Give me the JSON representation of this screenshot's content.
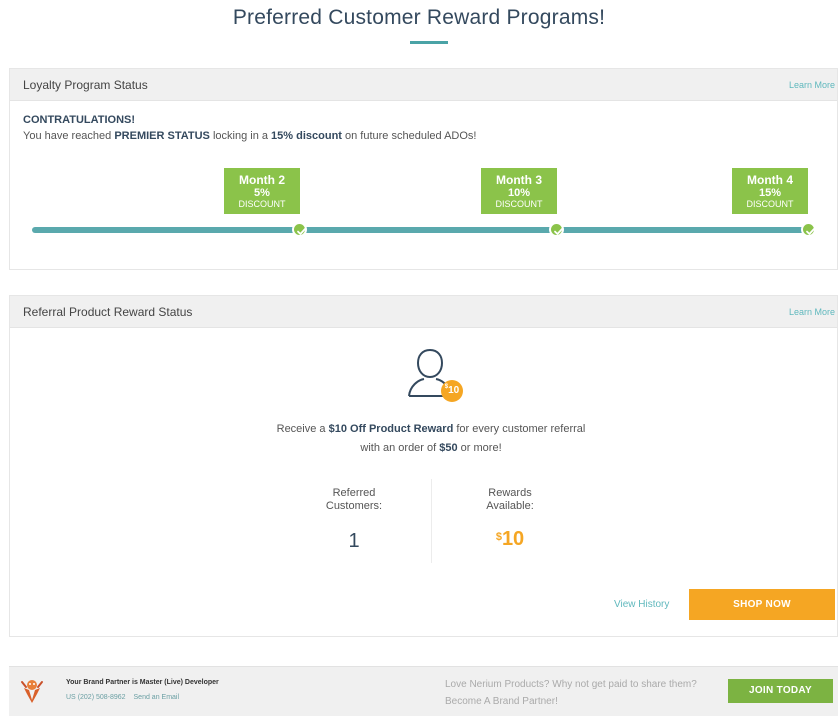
{
  "page": {
    "title": "Preferred Customer Reward Programs!"
  },
  "loyalty": {
    "header_title": "Loyalty Program Status",
    "learn_more": "Learn More",
    "congrats_heading": "CONTRATULATIONS!",
    "message_prefix": "You have reached ",
    "message_status": "PREMIER STATUS",
    "message_middle": " locking in a ",
    "message_discount": "15% discount",
    "message_suffix": " on future scheduled ADOs!",
    "milestones": [
      {
        "month": "Month 2",
        "percent": "5%",
        "label": "DISCOUNT"
      },
      {
        "month": "Month 3",
        "percent": "10%",
        "label": "DISCOUNT"
      },
      {
        "month": "Month 4",
        "percent": "15%",
        "label": "DISCOUNT"
      }
    ],
    "progress_fraction": 1.0
  },
  "referral": {
    "header_title": "Referral Product Reward Status",
    "learn_more": "Learn More",
    "badge_currency": "$",
    "badge_amount": "10",
    "desc_prefix": "Receive a ",
    "desc_reward": "$10 Off Product Reward",
    "desc_middle": " for every customer referral with an order of ",
    "desc_min": "$50",
    "desc_suffix": " or more!",
    "referred_label_1": "Referred",
    "referred_label_2": "Customers:",
    "referred_value": "1",
    "rewards_label_1": "Rewards",
    "rewards_label_2": "Available:",
    "rewards_currency": "$",
    "rewards_value": "10",
    "view_history": "View History",
    "shop_now": "SHOP NOW"
  },
  "footer": {
    "partner_prefix": "Your Brand Partner is ",
    "partner_name": "Master (Live) Developer",
    "country": "US",
    "phone": "(202) 508-8962",
    "email_link": "Send an Email",
    "promo_text": "Love Nerium Products? Why not get paid to share them?",
    "promo_link": "Become A Brand Partner!",
    "join_button": "JOIN TODAY"
  },
  "colors": {
    "accent_teal": "#5aa9ad",
    "milestone_green": "#8bc34a",
    "orange": "#f5a623",
    "join_green": "#7cb342",
    "heading_navy": "#34495e"
  },
  "icons": {
    "milestone_check": "check-circle-icon",
    "referral_avatar": "user-outline-icon",
    "partner_avatar": "mascot-avatar-icon"
  }
}
